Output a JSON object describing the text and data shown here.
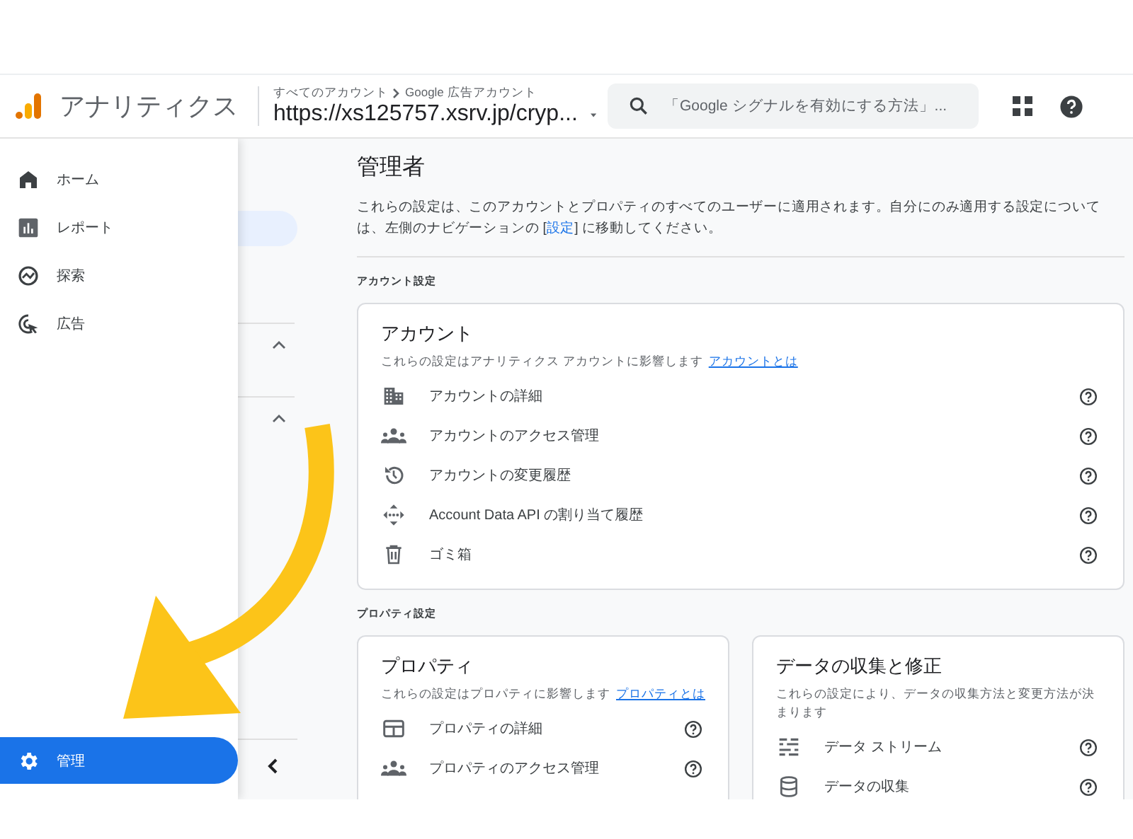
{
  "header": {
    "product": "アナリティクス",
    "breadcrumb": [
      "すべてのアカウント",
      "Google 広告アカウント"
    ],
    "account": "https://xs125757.xsrv.jp/cryp...",
    "search": {
      "placeholder": "「Google シグナルを有効にする方法」..."
    }
  },
  "sidebar": {
    "items": [
      {
        "label": "ホーム",
        "kind": "home",
        "selected": false
      },
      {
        "label": "レポート",
        "kind": "report",
        "selected": false
      },
      {
        "label": "探索",
        "kind": "explore",
        "selected": false
      },
      {
        "label": "広告",
        "kind": "ads",
        "selected": false
      }
    ],
    "admin": {
      "label": "管理",
      "selected": true
    }
  },
  "page": {
    "title": "管理者",
    "description_before": "これらの設定は、このアカウントとプロパティのすべてのユーザーに適用されます。自分にのみ適用する設定については、左側のナビゲーションの [",
    "description_link": "設定",
    "description_after": "] に移動してください。",
    "sections": [
      {
        "heading": "アカウント設定",
        "cards": [
          {
            "title": "アカウント",
            "subtitle": "これらの設定はアナリティクス アカウントに影響します",
            "link": "アカウントとは",
            "rows": [
              {
                "kind": "building",
                "label": "アカウントの詳細"
              },
              {
                "kind": "people",
                "label": "アカウントのアクセス管理"
              },
              {
                "kind": "history",
                "label": "アカウントの変更履歴"
              },
              {
                "kind": "api",
                "label": "Account Data API の割り当て履歴"
              },
              {
                "kind": "trash",
                "label": "ゴミ箱"
              }
            ]
          }
        ]
      },
      {
        "heading": "プロパティ設定",
        "cards": [
          {
            "title": "プロパティ",
            "subtitle": "これらの設定はプロパティに影響します",
            "link": "プロパティとは",
            "rows": [
              {
                "kind": "card",
                "label": "プロパティの詳細"
              },
              {
                "kind": "people",
                "label": "プロパティのアクセス管理"
              }
            ]
          },
          {
            "title": "データの収集と修正",
            "subtitle": "これらの設定により、データの収集方法と変更方法が決まります",
            "rows": [
              {
                "kind": "stream",
                "label": "データ ストリーム"
              },
              {
                "kind": "database",
                "label": "データの収集"
              }
            ]
          }
        ]
      }
    ]
  }
}
